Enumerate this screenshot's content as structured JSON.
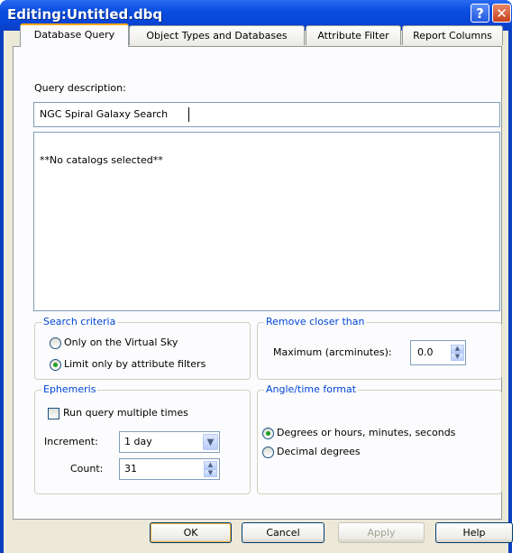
{
  "window": {
    "title": "Editing:Untitled.dbq",
    "help_label": "?",
    "close_label": "✕"
  },
  "tabs": [
    {
      "label": "Database Query",
      "active": true
    },
    {
      "label": "Object Types and Databases",
      "active": false
    },
    {
      "label": "Attribute Filter",
      "active": false
    },
    {
      "label": "Report Columns",
      "active": false
    }
  ],
  "query": {
    "description_label": "Query description:",
    "description_value": "NGC Spiral Galaxy Search",
    "catalogs_text": "**No catalogs selected**"
  },
  "search_criteria": {
    "title": "Search criteria",
    "option_virtual_sky": "Only on the Virtual Sky",
    "option_attribute_filters": "Limit only by attribute filters",
    "selected": "Limit only by attribute filters"
  },
  "remove_closer": {
    "title": "Remove closer than",
    "maximum_label": "Maximum (arcminutes):",
    "maximum_value": "0.0"
  },
  "ephemeris": {
    "title": "Ephemeris",
    "run_multiple_label": "Run query multiple times",
    "run_multiple_checked": false,
    "increment_label": "Increment:",
    "increment_value": "1 day",
    "count_label": "Count:",
    "count_value": "31"
  },
  "angle_time": {
    "title": "Angle/time format",
    "option_degrees_hms": "Degrees or hours, minutes, seconds",
    "option_decimal": "Decimal degrees",
    "selected": "Degrees or hours, minutes, seconds"
  },
  "buttons": {
    "ok": "OK",
    "cancel": "Cancel",
    "apply": "Apply",
    "help": "Help"
  }
}
